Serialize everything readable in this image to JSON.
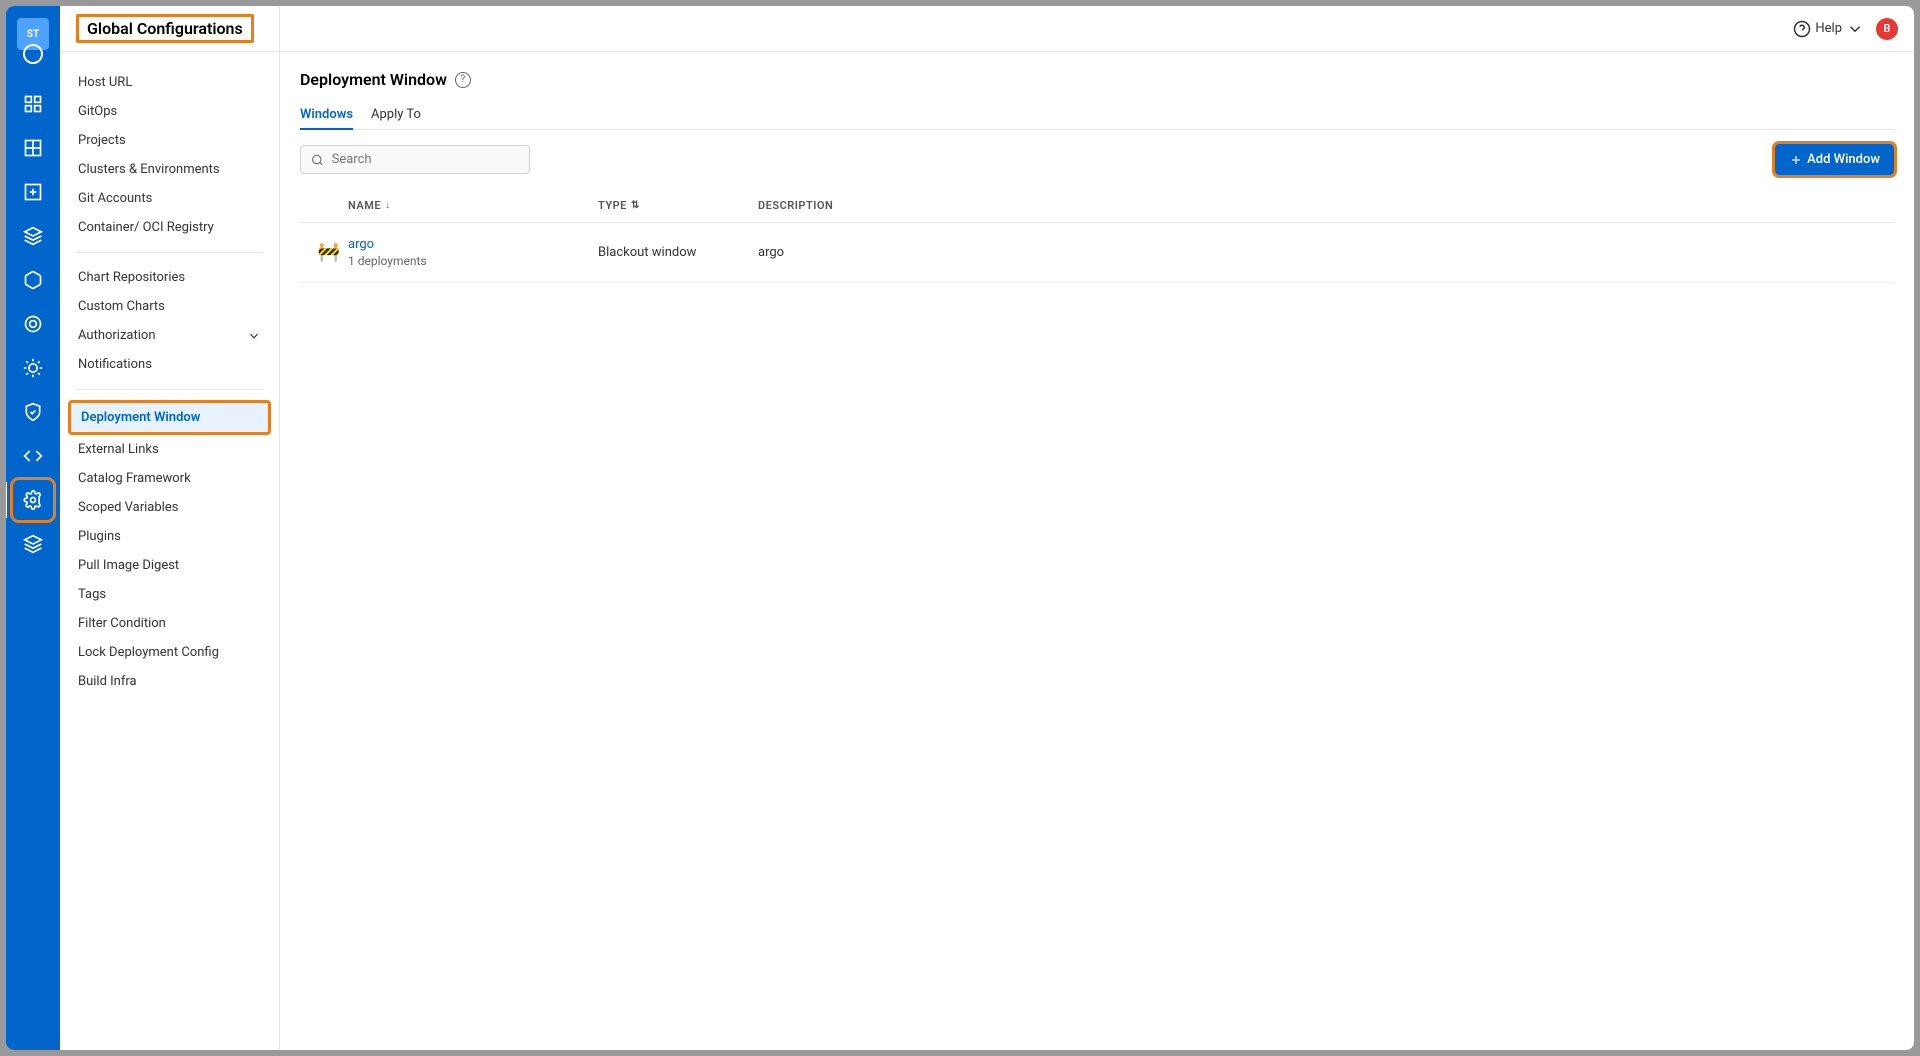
{
  "header": {
    "title": "Global Configurations",
    "help": "Help",
    "avatar": "B"
  },
  "rail": {
    "logo": "ST"
  },
  "sidebar": {
    "group1": [
      "Host URL",
      "GitOps",
      "Projects",
      "Clusters & Environments",
      "Git Accounts",
      "Container/ OCI Registry"
    ],
    "group2": [
      "Chart Repositories",
      "Custom Charts"
    ],
    "authorization": "Authorization",
    "group3": [
      "Notifications"
    ],
    "selected": "Deployment Window",
    "group4": [
      "External Links",
      "Catalog Framework",
      "Scoped Variables",
      "Plugins",
      "Pull Image Digest",
      "Tags",
      "Filter Condition",
      "Lock Deployment Config",
      "Build Infra"
    ]
  },
  "page": {
    "title": "Deployment Window",
    "tabs": {
      "windows": "Windows",
      "applyTo": "Apply To"
    },
    "search_placeholder": "Search",
    "add_button": "Add Window"
  },
  "columns": {
    "name": "NAME",
    "type": "TYPE",
    "desc": "DESCRIPTION"
  },
  "rows": [
    {
      "icon": "🚧",
      "name": "argo",
      "sub": "1 deployments",
      "type": "Blackout window",
      "desc": "argo"
    }
  ]
}
